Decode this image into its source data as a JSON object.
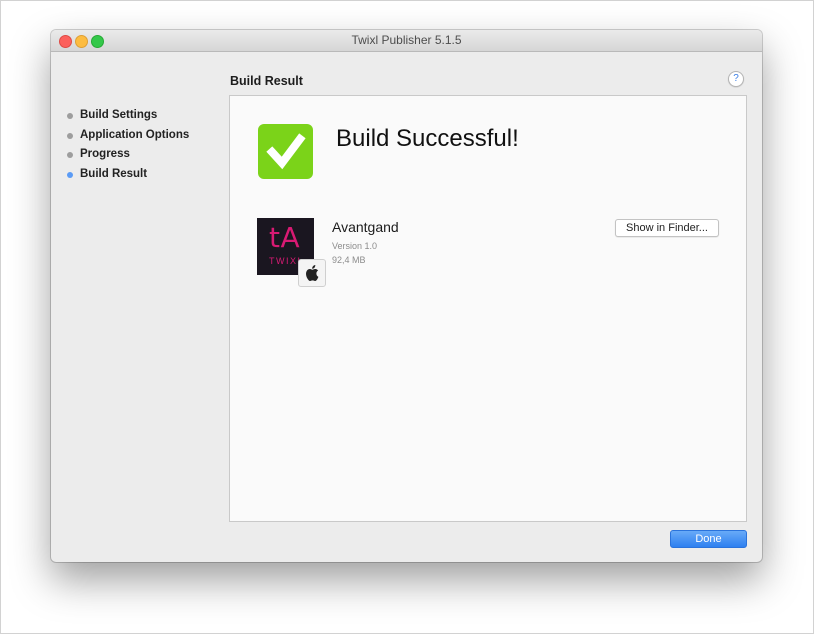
{
  "window": {
    "title": "Twixl Publisher 5.1.5"
  },
  "sidebar": {
    "steps": [
      {
        "label": "Build Settings",
        "active": false
      },
      {
        "label": "Application Options",
        "active": false
      },
      {
        "label": "Progress",
        "active": false
      },
      {
        "label": "Build Result",
        "active": true
      }
    ]
  },
  "main": {
    "section_title": "Build Result",
    "help_label": "?",
    "success_title": "Build Successful!",
    "app": {
      "icon_text": "tA",
      "icon_subtext": "TWIXL",
      "name": "Avantgand",
      "version": "Version  1.0",
      "size": "92,4 MB",
      "platform_icon": "apple-icon"
    },
    "show_in_finder_label": "Show in Finder...",
    "done_label": "Done"
  },
  "colors": {
    "success_green": "#7bd319",
    "accent_blue": "#2e80f0",
    "active_dot": "#5b9bf5",
    "app_icon_pink": "#d81a73"
  }
}
